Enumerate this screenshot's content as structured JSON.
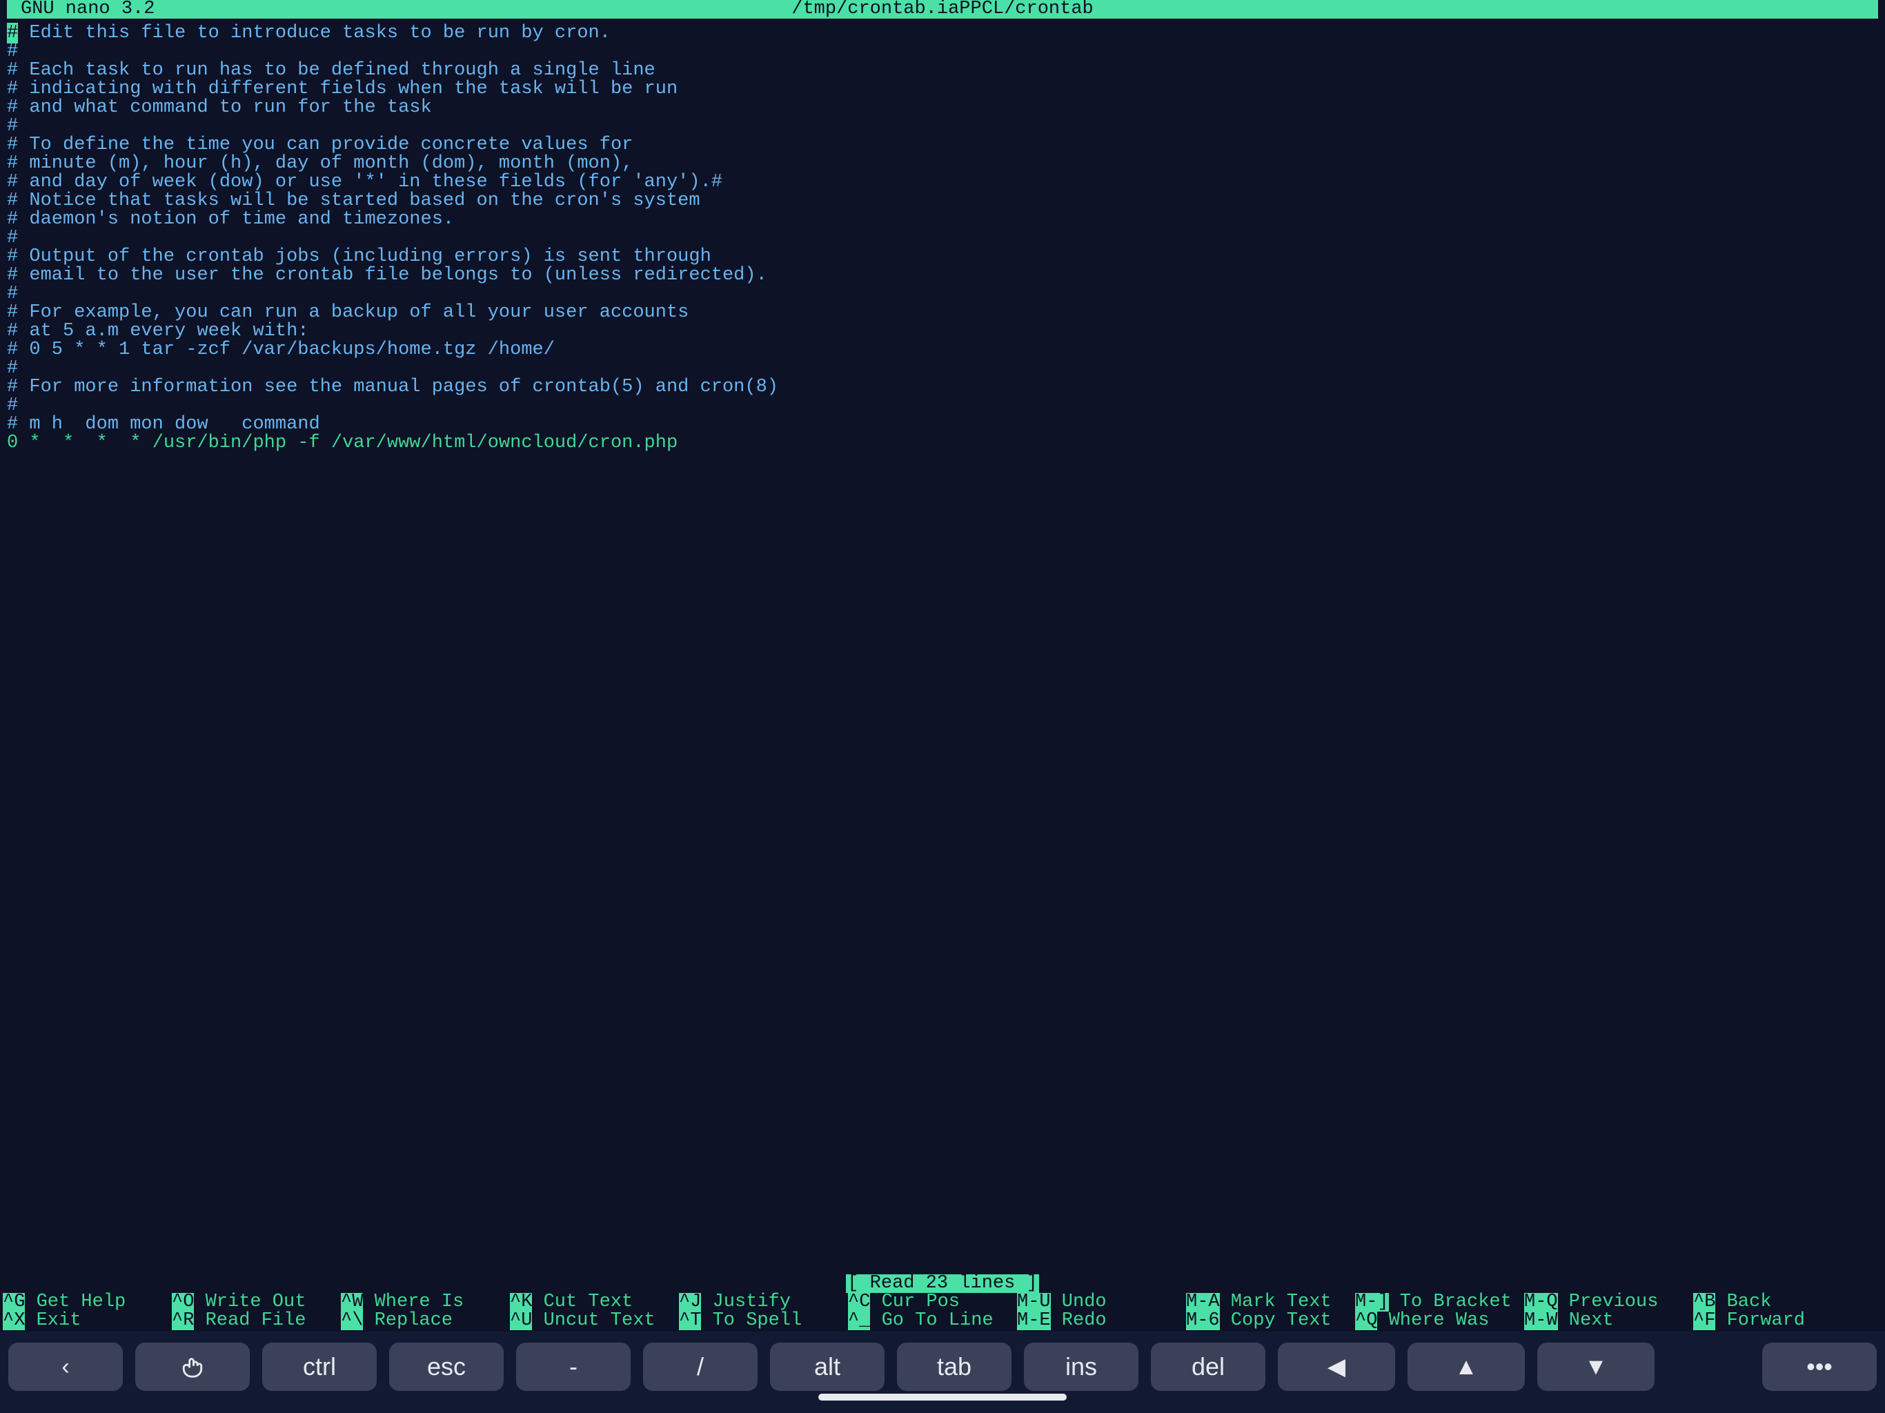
{
  "title": {
    "app": "  GNU nano 3.2",
    "file": "/tmp/crontab.iaPPCL/crontab"
  },
  "editor": {
    "cursor_char": "#",
    "lines": [
      " Edit this file to introduce tasks to be run by cron.",
      "#",
      "# Each task to run has to be defined through a single line",
      "# indicating with different fields when the task will be run",
      "# and what command to run for the task",
      "#",
      "# To define the time you can provide concrete values for",
      "# minute (m), hour (h), day of month (dom), month (mon),",
      "# and day of week (dow) or use '*' in these fields (for 'any').#",
      "# Notice that tasks will be started based on the cron's system",
      "# daemon's notion of time and timezones.",
      "#",
      "# Output of the crontab jobs (including errors) is sent through",
      "# email to the user the crontab file belongs to (unless redirected).",
      "#",
      "# For example, you can run a backup of all your user accounts",
      "# at 5 a.m every week with:",
      "# 0 5 * * 1 tar -zcf /var/backups/home.tgz /home/",
      "#",
      "# For more information see the manual pages of crontab(5) and cron(8)",
      "#",
      "# m h  dom mon dow   command"
    ],
    "content_line": "0 *  *  *  * /usr/bin/php -f /var/www/html/owncloud/cron.php"
  },
  "status": "[ Read 23 lines ]",
  "shortcuts": {
    "row1": [
      {
        "key": "^G",
        "label": "Get Help"
      },
      {
        "key": "^O",
        "label": "Write Out"
      },
      {
        "key": "^W",
        "label": "Where Is"
      },
      {
        "key": "^K",
        "label": "Cut Text"
      },
      {
        "key": "^J",
        "label": "Justify"
      },
      {
        "key": "^C",
        "label": "Cur Pos"
      },
      {
        "key": "M-U",
        "label": "Undo"
      },
      {
        "key": "M-A",
        "label": "Mark Text"
      },
      {
        "key": "M-]",
        "label": "To Bracket"
      },
      {
        "key": "M-Q",
        "label": "Previous"
      },
      {
        "key": "^B",
        "label": "Back"
      }
    ],
    "row2": [
      {
        "key": "^X",
        "label": "Exit"
      },
      {
        "key": "^R",
        "label": "Read File"
      },
      {
        "key": "^\\",
        "label": "Replace"
      },
      {
        "key": "^U",
        "label": "Uncut Text"
      },
      {
        "key": "^T",
        "label": "To Spell"
      },
      {
        "key": "^_",
        "label": "Go To Line"
      },
      {
        "key": "M-E",
        "label": "Redo"
      },
      {
        "key": "M-6",
        "label": "Copy Text"
      },
      {
        "key": "^Q",
        "label": "Where Was"
      },
      {
        "key": "M-W",
        "label": "Next"
      },
      {
        "key": "^F",
        "label": "Forward"
      }
    ]
  },
  "toolbar": {
    "ctrl": "ctrl",
    "esc": "esc",
    "dash": "-",
    "slash": "/",
    "alt": "alt",
    "tab": "tab",
    "ins": "ins",
    "del": "del"
  }
}
